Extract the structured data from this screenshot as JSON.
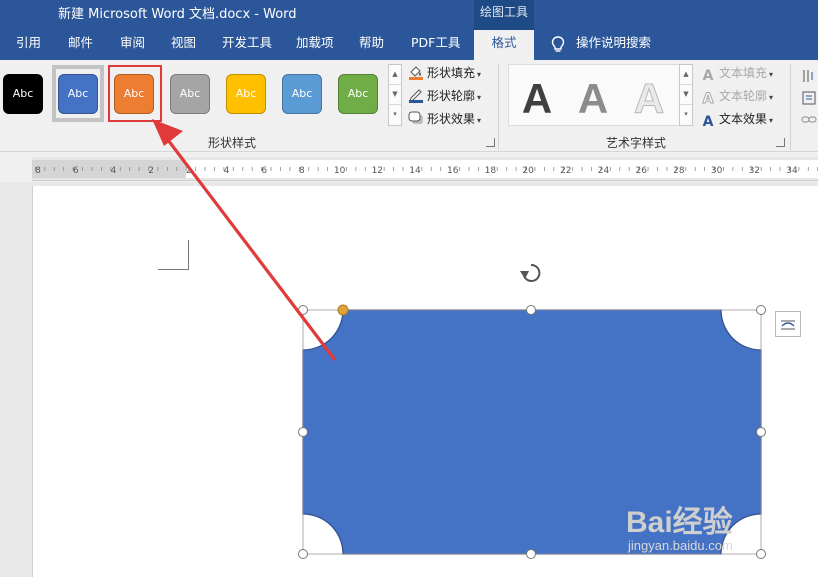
{
  "titlebar": {
    "doc_title": "新建 Microsoft Word 文档.docx  -  Word",
    "context_label": "绘图工具"
  },
  "tabs": [
    {
      "label": "引用"
    },
    {
      "label": "邮件"
    },
    {
      "label": "审阅"
    },
    {
      "label": "视图"
    },
    {
      "label": "开发工具"
    },
    {
      "label": "加载项"
    },
    {
      "label": "帮助"
    },
    {
      "label": "PDF工具"
    },
    {
      "label": "格式",
      "active": true
    }
  ],
  "search": {
    "label": "操作说明搜索",
    "icon": "lightbulb-icon"
  },
  "shape_styles": {
    "group_label": "形状样式",
    "items": [
      {
        "label": "Abc",
        "color": "#000000"
      },
      {
        "label": "Abc",
        "color": "#4472c4"
      },
      {
        "label": "Abc",
        "color": "#ed7d31"
      },
      {
        "label": "Abc",
        "color": "#a5a5a5"
      },
      {
        "label": "Abc",
        "color": "#ffc000"
      },
      {
        "label": "Abc",
        "color": "#5b9bd5"
      },
      {
        "label": "Abc",
        "color": "#70ad47"
      }
    ],
    "commands": [
      {
        "label": "形状填充",
        "icon": "paint-bucket-icon"
      },
      {
        "label": "形状轮廓",
        "icon": "pen-outline-icon"
      },
      {
        "label": "形状效果",
        "icon": "shape-effects-icon"
      }
    ]
  },
  "wordart": {
    "group_label": "艺术字样式",
    "letter": "A",
    "commands": [
      {
        "label": "文本填充",
        "icon": "text-fill-icon",
        "enabled": false
      },
      {
        "label": "文本轮廓",
        "icon": "text-outline-icon",
        "enabled": false
      },
      {
        "label": "文本效果",
        "icon": "text-effects-icon",
        "enabled": true
      }
    ]
  },
  "ruler": {
    "labels": [
      "8",
      "6",
      "4",
      "2",
      "2",
      "4",
      "6",
      "8",
      "10",
      "12",
      "14",
      "16",
      "18",
      "20",
      "22",
      "24",
      "26",
      "28",
      "30",
      "32",
      "34"
    ]
  },
  "shape": {
    "fill": "#4472c4",
    "outline": "#2f528f",
    "type": "snip-rounded-rectangle"
  },
  "colors": {
    "title_bar": "#2b579a",
    "accent_red": "#e03a3a",
    "handle_yellow": "#e0a23a"
  },
  "watermark": {
    "logo": "Bai经验",
    "url_text": "jingyan.baidu.com"
  }
}
